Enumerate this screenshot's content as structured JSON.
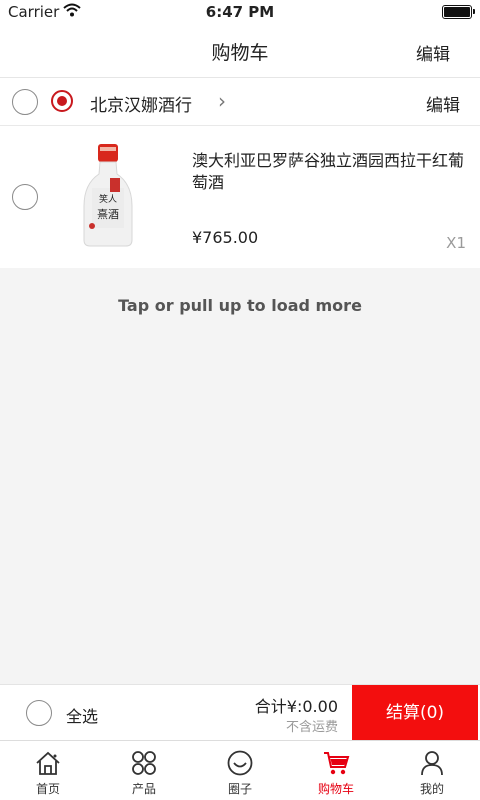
{
  "status_bar": {
    "carrier": "Carrier",
    "time": "6:47 PM"
  },
  "nav": {
    "title": "购物车",
    "edit_label": "编辑"
  },
  "store": {
    "name": "北京汉娜酒行",
    "chevron": "›",
    "edit_label": "编辑"
  },
  "cart_item": {
    "title": "澳大利亚巴罗萨谷独立酒园西拉干红葡萄酒",
    "price": "¥765.00",
    "quantity": "X1"
  },
  "load_more": "Tap or pull up to load more",
  "checkout": {
    "select_all_label": "全选",
    "total": "合计¥:0.00",
    "shipping_note": "不含运费",
    "checkout_label": "结算(0)"
  },
  "tabs": [
    {
      "label": "首页",
      "icon": "home-icon"
    },
    {
      "label": "产品",
      "icon": "grid-icon"
    },
    {
      "label": "圈子",
      "icon": "smile-icon"
    },
    {
      "label": "购物车",
      "icon": "cart-icon",
      "active": true
    },
    {
      "label": "我的",
      "icon": "user-icon"
    }
  ],
  "colors": {
    "accent": "#e60012",
    "checkout": "#f30e0e"
  }
}
